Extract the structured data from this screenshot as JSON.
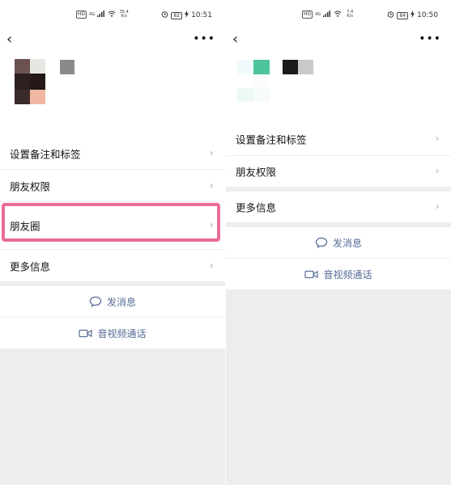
{
  "left": {
    "status": {
      "net_tag": "HD",
      "signal": "4G",
      "speed_value": "35.4",
      "speed_unit": "K/s",
      "battery": "82",
      "time": "10:51"
    },
    "nav": {
      "back_glyph": "‹",
      "more_glyph": "•••"
    },
    "rows": [
      {
        "label": "设置备注和标签",
        "chevron": "›"
      },
      {
        "label": "朋友权限",
        "chevron": "›"
      },
      {
        "label": "朋友圈",
        "chevron": "›"
      },
      {
        "label": "更多信息",
        "chevron": "›"
      }
    ],
    "actions": {
      "message": "发消息",
      "video_call": "音视频通话"
    },
    "highlight_color": "#e96b98"
  },
  "right": {
    "status": {
      "net_tag": "HD",
      "signal": "4G",
      "speed_value": "7.4",
      "speed_unit": "K/s",
      "battery": "84",
      "time": "10:50"
    },
    "nav": {
      "back_glyph": "‹",
      "more_glyph": "•••"
    },
    "rows": [
      {
        "label": "设置备注和标签",
        "chevron": "›"
      },
      {
        "label": "朋友权限",
        "chevron": "›"
      },
      {
        "label": "更多信息",
        "chevron": "›"
      }
    ],
    "actions": {
      "message": "发消息",
      "video_call": "音视频通话"
    }
  },
  "colors": {
    "link": "#576b95",
    "background": "#ededed",
    "chevron": "#b3b3b3"
  }
}
